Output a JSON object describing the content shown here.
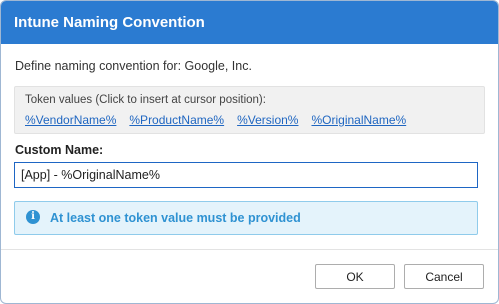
{
  "window": {
    "title": "Intune Naming Convention"
  },
  "description": "Define naming convention for: Google, Inc.",
  "tokens": {
    "caption": "Token values (Click to insert at cursor position):",
    "items": [
      "%VendorName%",
      "%ProductName%",
      "%Version%",
      "%OriginalName%"
    ]
  },
  "custom_name": {
    "label": "Custom Name:",
    "value": "[App] - %OriginalName%"
  },
  "info": {
    "icon": "info-icon",
    "message": "At least one token value must be provided"
  },
  "buttons": {
    "ok": "OK",
    "cancel": "Cancel"
  },
  "colors": {
    "titlebar": "#2b7bd1",
    "link": "#1f66c1",
    "info_text": "#2f92d2",
    "info_background": "#e4f3fb"
  }
}
